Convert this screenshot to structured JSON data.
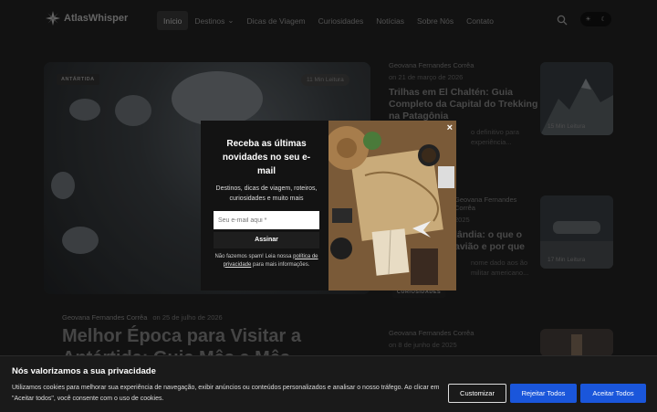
{
  "header": {
    "logo_text": "AtlasWhisper",
    "nav": [
      {
        "label": "Início",
        "active": true
      },
      {
        "label": "Destinos",
        "has_dropdown": true
      },
      {
        "label": "Dicas de Viagem"
      },
      {
        "label": "Curiosidades"
      },
      {
        "label": "Notícias"
      },
      {
        "label": "Sobre Nós"
      },
      {
        "label": "Contato"
      }
    ],
    "theme_icons": [
      "sun-icon",
      "moon-icon"
    ]
  },
  "hero": {
    "tag": "ANTÁRTIDA",
    "read_time": "11 Min Leitura",
    "author": "Geovana Fernandes Corrêa",
    "date": "on 25 de julho de 2026",
    "title": "Melhor Época para Visitar a Antártida: Guia Mês a Mês"
  },
  "side_articles": [
    {
      "author": "Geovana Fernandes Corrêa",
      "date": "on 21 de março de 2026",
      "title": "Trilhas em El Chaltén: Guia Completo da Capital do Trekking na Patagônia",
      "excerpt": "o definitivo para experiência...",
      "read_time": "15 Min Leitura"
    },
    {
      "author": "Geovana Fernandes Corrêa",
      "date": "2025",
      "title": "lândia: o que o avião e por que",
      "excerpt": "nome dado aos ão militar americano...",
      "read_time": "17 Min Leitura",
      "tag": "CURIOSIDADES"
    },
    {
      "author": "Geovana Fernandes Corrêa",
      "date": "on 8 de junho de 2025",
      "title": "",
      "excerpt": "",
      "read_time": ""
    }
  ],
  "newsletter": {
    "title": "Receba as últimas novidades no seu e-mail",
    "subtitle": "Destinos, dicas de viagem, roteiros, curiosidades e muito mais",
    "email_placeholder": "Seu e-mail aqui *",
    "button": "Assinar",
    "spam_text": "Não fazemos spam! Leia nossa",
    "privacy_link": "política de privacidade",
    "spam_suffix": "para mais informações.",
    "close": "×"
  },
  "cookie": {
    "title": "Nós valorizamos a sua privacidade",
    "text": "Utilizamos cookies para melhorar sua experiência de navegação, exibir anúncios ou conteúdos personalizados e analisar o nosso tráfego. Ao clicar em \"Aceitar todos\", você consente com o uso de cookies.",
    "customize": "Customizar",
    "reject": "Rejeitar Todos",
    "accept": "Aceitar Todos"
  },
  "colors": {
    "accent": "#1a56db",
    "background": "#1d1d1d",
    "modal": "#131313"
  }
}
